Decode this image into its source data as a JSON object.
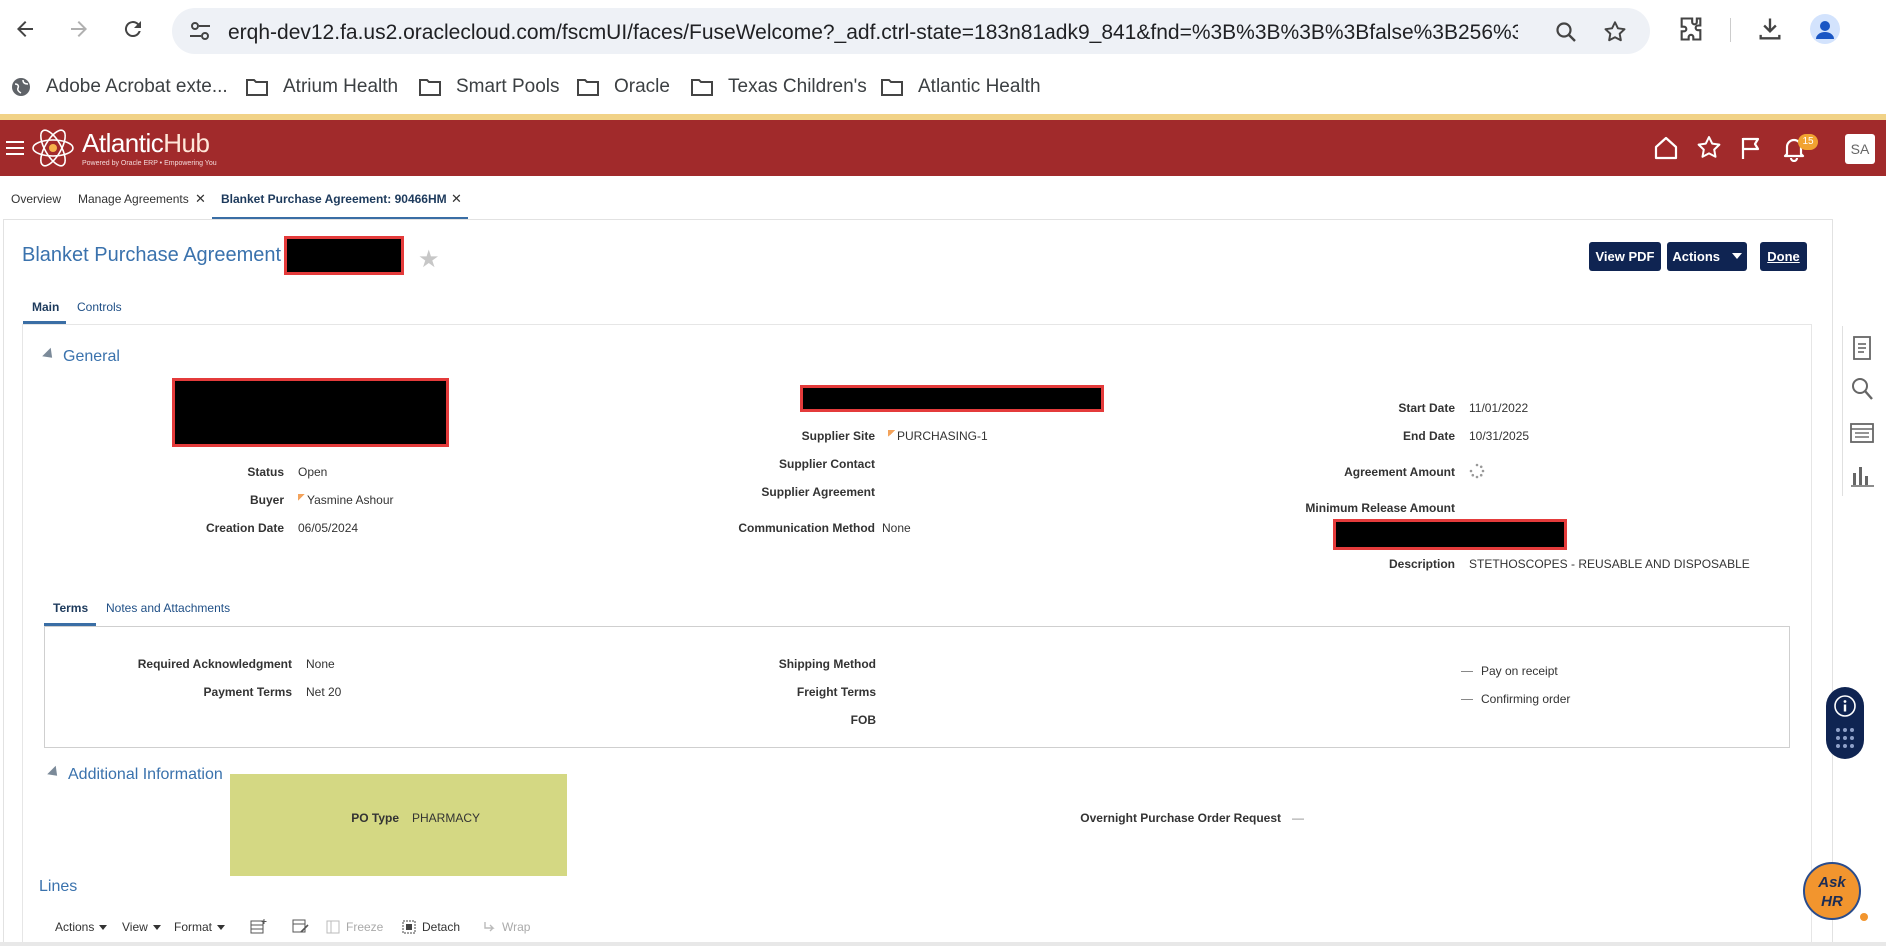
{
  "browser": {
    "url": "erqh-dev12.fa.us2.oraclecloud.com/fscmUI/faces/FuseWelcome?_adf.ctrl-state=183n81adk9_841&fnd=%3B%3B%3B%3Bfalse%3B256%3B%...",
    "bookmarks": [
      "Adobe Acrobat exte...",
      "Atrium Health",
      "Smart Pools",
      "Oracle",
      "Texas Children's",
      "Atlantic Health"
    ]
  },
  "app": {
    "brand_main": "Atlantic",
    "brand_hub": "Hub",
    "brand_tagline": "Powered by Oracle ERP • Empowering You",
    "notification_count": "15",
    "avatar_initials": "SA"
  },
  "tabs": [
    {
      "label": "Overview"
    },
    {
      "label": "Manage Agreements"
    },
    {
      "label": "Blanket Purchase Agreement: 90466HM"
    }
  ],
  "page": {
    "title": "Blanket Purchase Agreement",
    "buttons": {
      "view_pdf": "View PDF",
      "actions": "Actions",
      "done": "Done"
    },
    "subtabs": [
      "Main",
      "Controls"
    ]
  },
  "general": {
    "heading": "General",
    "left": [
      {
        "label": "Status",
        "value": "Open"
      },
      {
        "label": "Buyer",
        "value": "Yasmine Ashour"
      },
      {
        "label": "Creation Date",
        "value": "06/05/2024"
      }
    ],
    "middle": [
      {
        "label": "Supplier Site",
        "value": "PURCHASING-1"
      },
      {
        "label": "Supplier Contact",
        "value": ""
      },
      {
        "label": "Supplier Agreement",
        "value": ""
      },
      {
        "label": "Communication Method",
        "value": "None"
      }
    ],
    "right": [
      {
        "label": "Start Date",
        "value": "11/01/2022"
      },
      {
        "label": "End Date",
        "value": "10/31/2025"
      },
      {
        "label": "Agreement Amount",
        "value": ""
      },
      {
        "label": "Minimum Release Amount",
        "value": ""
      },
      {
        "label": "Description",
        "value": "STETHOSCOPES - REUSABLE AND DISPOSABLE"
      }
    ]
  },
  "terms": {
    "subtabs": [
      "Terms",
      "Notes and Attachments"
    ],
    "left": [
      {
        "label": "Required Acknowledgment",
        "value": "None"
      },
      {
        "label": "Payment Terms",
        "value": "Net 20"
      }
    ],
    "middle": [
      {
        "label": "Shipping Method",
        "value": ""
      },
      {
        "label": "Freight Terms",
        "value": ""
      },
      {
        "label": "FOB",
        "value": ""
      }
    ],
    "checks": [
      "Pay on receipt",
      "Confirming order"
    ]
  },
  "additional": {
    "heading": "Additional Information",
    "po_type_label": "PO Type",
    "po_type_value": "PHARMACY",
    "overnight_label": "Overnight Purchase Order Request",
    "overnight_value": "—"
  },
  "lines": {
    "heading": "Lines",
    "toolbar": [
      "Actions",
      "View",
      "Format",
      "Freeze",
      "Detach",
      "Wrap"
    ]
  },
  "widgets": {
    "askhr_line1": "Ask",
    "askhr_line2": "HR"
  },
  "colors": {
    "app_header": "#a12a2b",
    "accent_blue": "#3a72ad",
    "button_navy": "#0f2452",
    "redaction": "#000000",
    "highlight": "#d4d883"
  }
}
